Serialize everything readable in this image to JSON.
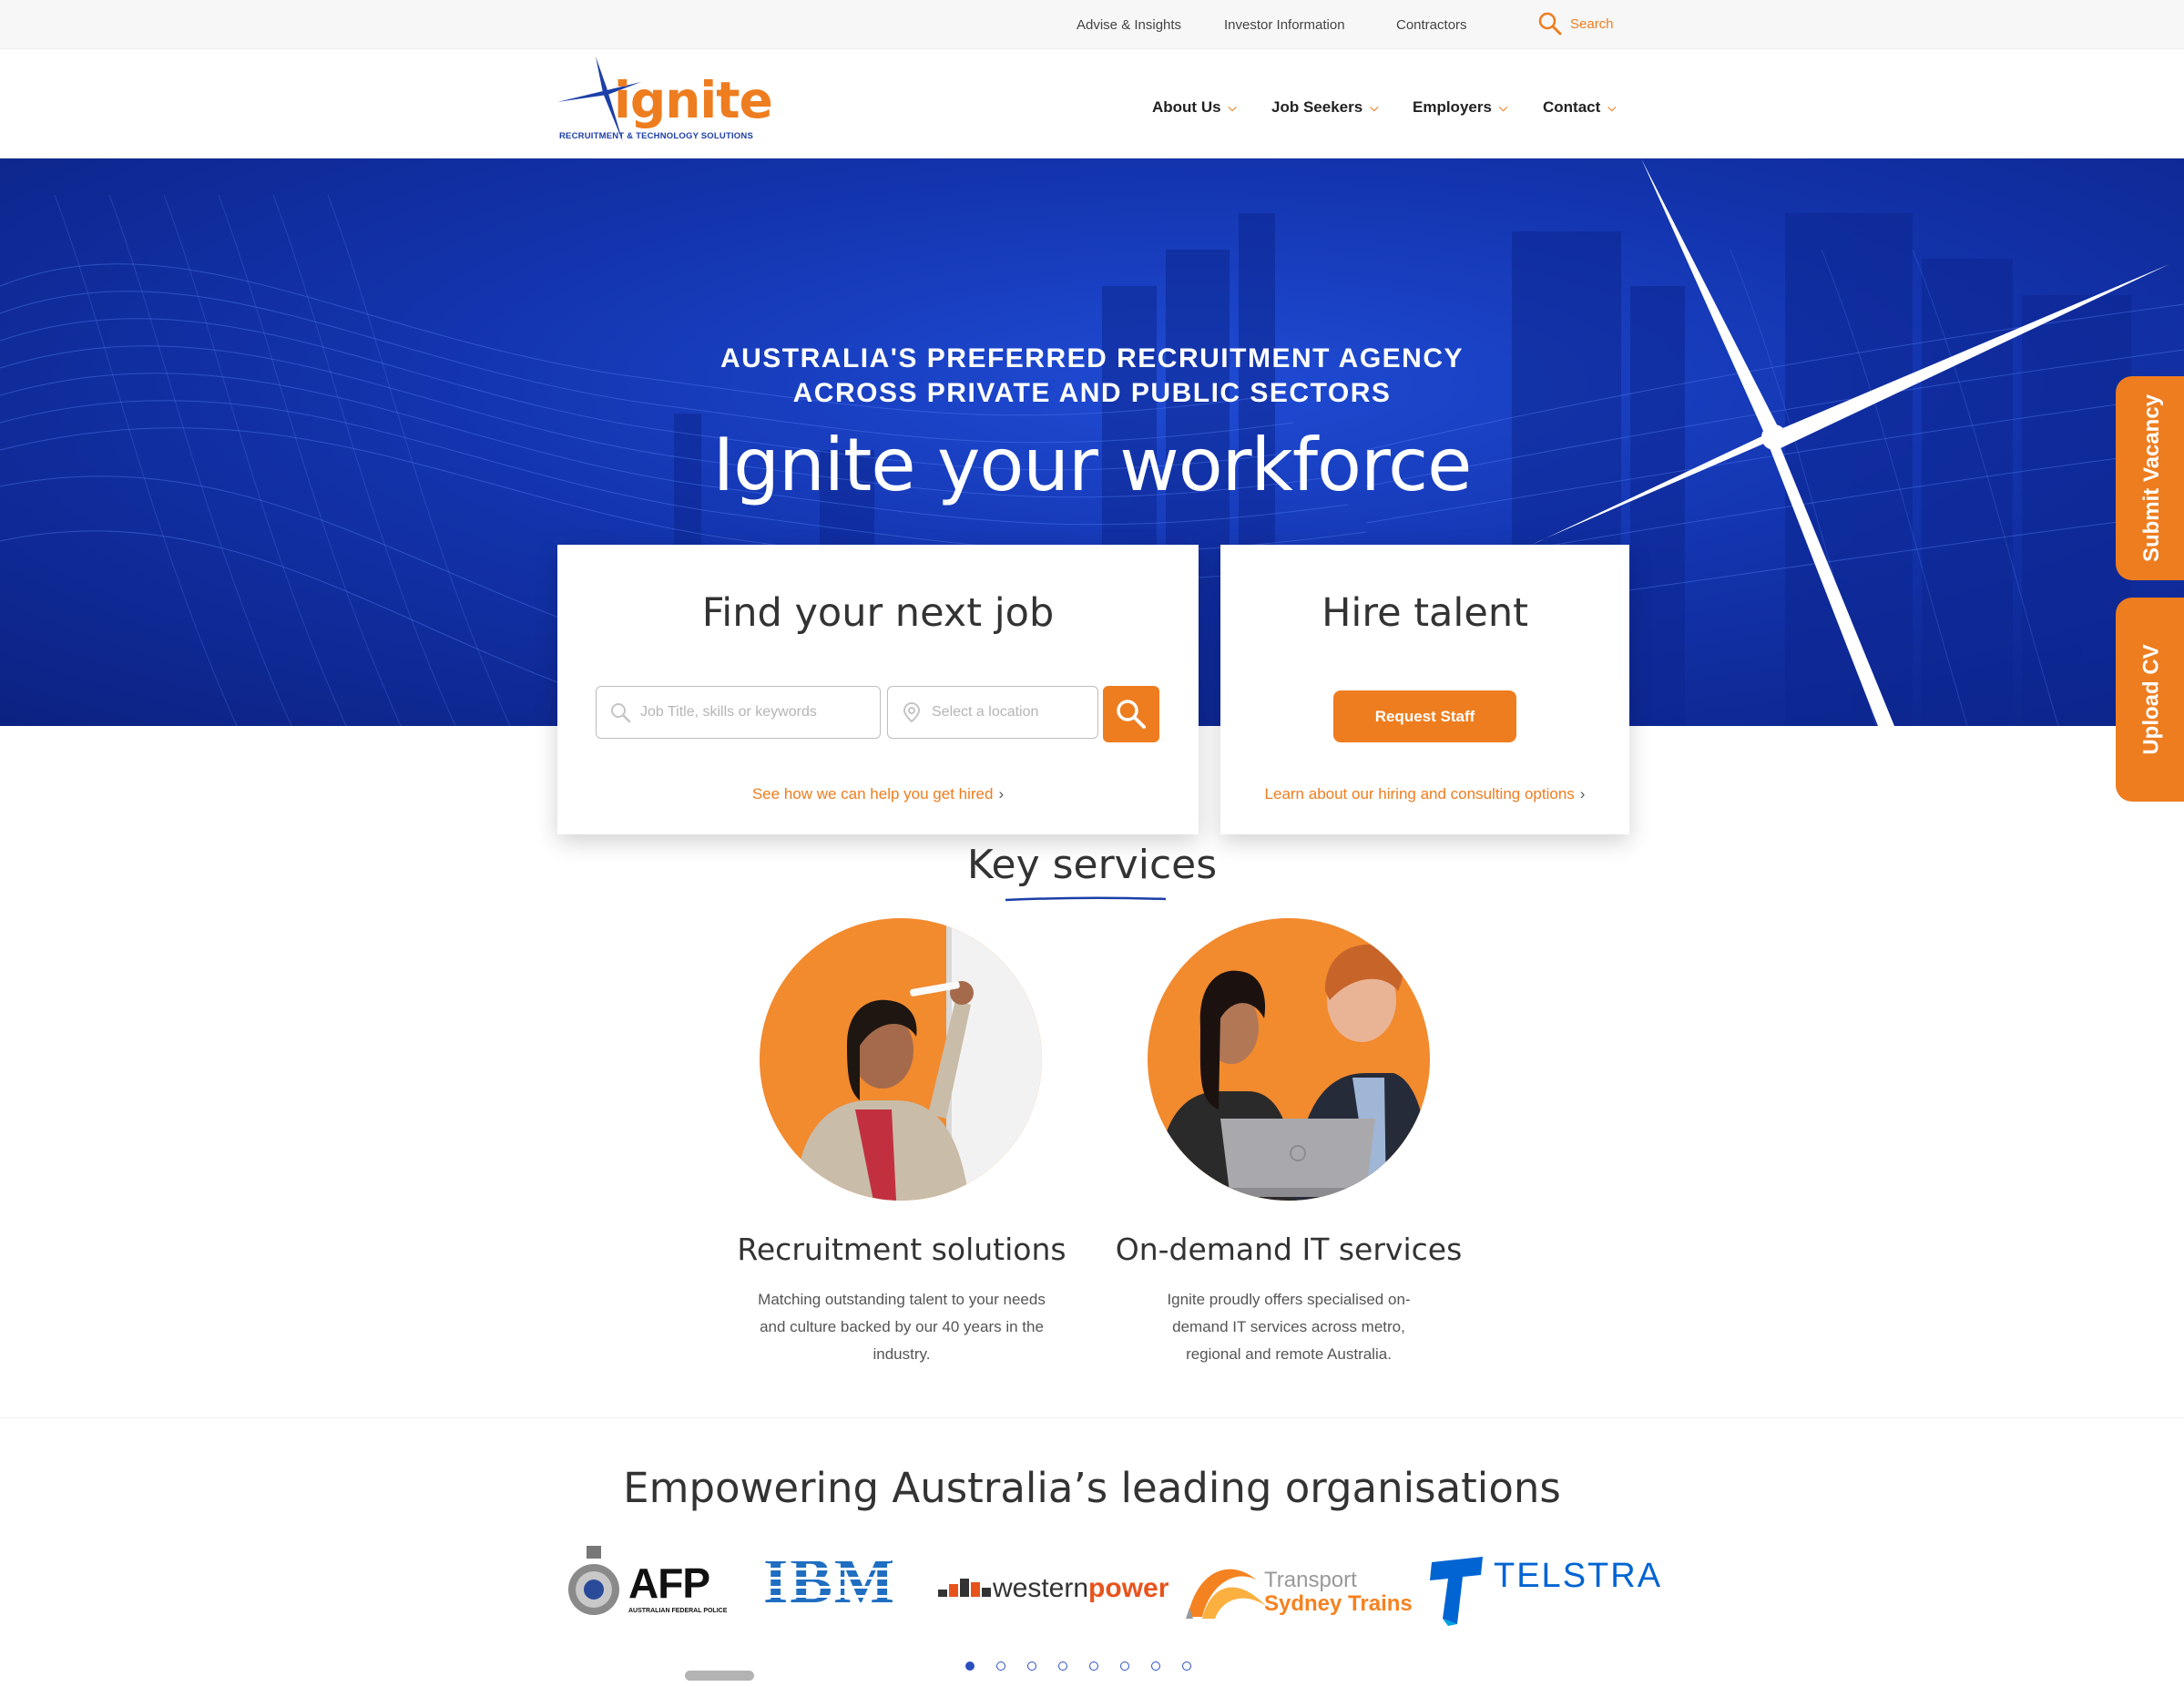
{
  "utility_bar": {
    "links": [
      "Advise & Insights",
      "Investor Information",
      "Contractors"
    ],
    "search_label": "Search"
  },
  "brand": {
    "name": "ignite",
    "tagline": "RECRUITMENT & TECHNOLOGY SOLUTIONS",
    "accent_color": "#ee7d1f",
    "blue_color": "#1c3fa8"
  },
  "nav": {
    "items": [
      {
        "label": "About Us"
      },
      {
        "label": "Job Seekers"
      },
      {
        "label": "Employers"
      },
      {
        "label": "Contact"
      }
    ]
  },
  "hero": {
    "kicker_line1": "AUSTRALIA'S PREFERRED RECRUITMENT AGENCY",
    "kicker_line2": "ACROSS PRIVATE AND PUBLIC SECTORS",
    "title": "Ignite your workforce"
  },
  "job_card": {
    "title": "Find your next job",
    "keyword_placeholder": "Job Title, skills or keywords",
    "location_placeholder": "Select a location",
    "link": "See how we can help you get hired"
  },
  "hire_card": {
    "title": "Hire talent",
    "button": "Request Staff",
    "link": "Learn about our hiring and consulting options"
  },
  "side_tabs": {
    "vacancy": "Submit Vacancy",
    "cv": "Upload CV"
  },
  "key_services": {
    "title": "Key services",
    "items": [
      {
        "name": "Recruitment solutions",
        "description": "Matching outstanding talent to your needs and culture backed by our 40 years in the industry."
      },
      {
        "name": "On-demand IT services",
        "description": "Ignite proudly offers specialised on-demand IT services across metro, regional and remote Australia."
      }
    ]
  },
  "clients": {
    "title": "Empowering Australia’s leading organisations",
    "logos": [
      {
        "name": "AFP",
        "sub": "AUSTRALIAN FEDERAL POLICE"
      },
      {
        "name": "IBM"
      },
      {
        "name": "westernpower",
        "part1": "western",
        "part2": "power"
      },
      {
        "name": "Transport Sydney Trains",
        "part1": "Transport",
        "part2": "Sydney Trains"
      },
      {
        "name": "TELSTRA"
      }
    ],
    "carousel_pages": 8,
    "active_page": 1
  }
}
